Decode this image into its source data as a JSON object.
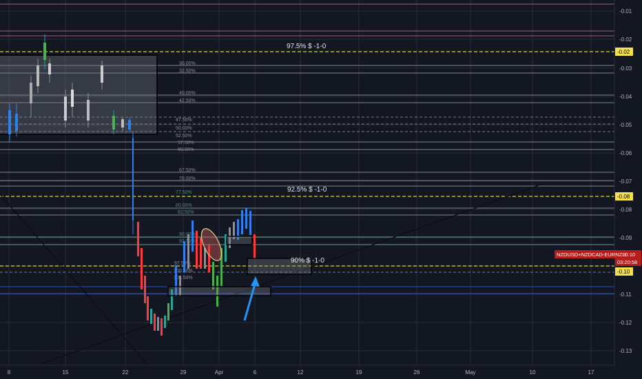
{
  "theme": {
    "background": "#131722",
    "panel": "#1e222d",
    "grid": "#2a2e39",
    "axis_text": "#b2b5be",
    "fib_line": "#9598a1",
    "fib_label": "#8a8e99",
    "fib_label_green": "#4e8f7e",
    "yellow_dashed": "#e5d22c",
    "pink_line": "#a35b7b",
    "blue_line": "#2962ff",
    "teal_line": "#6a9e96",
    "bull": "#26a69a",
    "bear": "#ef5350",
    "up_green": "#4caf50",
    "down_red": "#ff3b3b",
    "candle_blue": "#2f80ed",
    "price_label_bg": "#b71c1c",
    "arrow": "#2196f3"
  },
  "price_axis": {
    "ticks": [
      "-0.01",
      "-0.02",
      "-0.03",
      "-0.04",
      "-0.05",
      "-0.06",
      "-0.07",
      "-0.08",
      "-0.09",
      "-0.10",
      "-0.11",
      "-0.12",
      "-0.13"
    ],
    "highlight_labels": [
      "-0.02",
      "-0.08",
      "-0.10"
    ]
  },
  "time_axis": {
    "ticks": [
      "8",
      "15",
      "22",
      "29",
      "Apr",
      "6",
      "12",
      "19",
      "26",
      "May",
      "10",
      "17"
    ]
  },
  "symbol_label": {
    "name": "NZDUSD+NZDCAD-EURNZD",
    "value": "-0.10",
    "countdown": "03:20:58"
  },
  "annotations": {
    "level_975": "97.5% $ -1-0",
    "level_925": "92.5% $ -1-0",
    "level_90": "90% $ -1-0"
  },
  "fib_labels": {
    "upper": [
      "30.00%",
      "32.50%",
      "40.00%",
      "42.50%",
      "47.50%",
      "50.00%",
      "52.50%",
      "57.50%",
      "60.00%",
      "67.50%",
      "70.00%"
    ],
    "lower": [
      "77.50%",
      "80.00%",
      "82.50%",
      "90.00%",
      "92.50%",
      "97.50%",
      "100.00%",
      "102.50%"
    ]
  }
}
